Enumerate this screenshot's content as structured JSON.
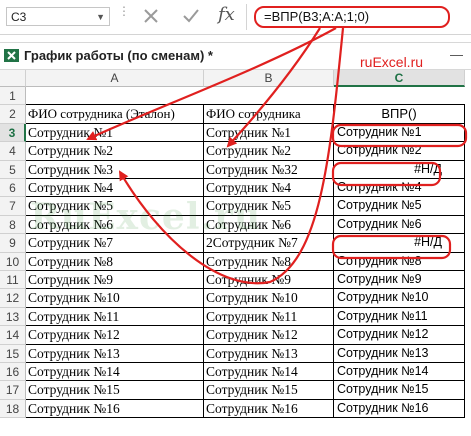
{
  "formula_bar": {
    "name_box": "C3",
    "formula": "=ВПР(B3;A:A;1;0)"
  },
  "workbook": {
    "title": "График работы (по сменам) *",
    "brand": "ruExcel.ru",
    "watermark": "RuExcel.ru"
  },
  "columns": [
    "A",
    "B",
    "C"
  ],
  "rows": [
    {
      "num": "1",
      "a": "",
      "b": "",
      "c": ""
    },
    {
      "num": "2",
      "a": "ФИО сотрудника (Эталон)",
      "b": "ФИО сотрудника",
      "c": "ВПР()"
    },
    {
      "num": "3",
      "a": "Сотрудник №1",
      "b": "Сотрудник №1",
      "c": "Сотрудник №1"
    },
    {
      "num": "4",
      "a": "Сотрудник №2",
      "b": "Сотрудник №2",
      "c": "Сотрудник №2"
    },
    {
      "num": "5",
      "a": "Сотрудник №3",
      "b": "Сотрудник №32",
      "c": "#Н/Д"
    },
    {
      "num": "6",
      "a": "Сотрудник №4",
      "b": "Сотрудник №4",
      "c": "Сотрудник №4"
    },
    {
      "num": "7",
      "a": "Сотрудник №5",
      "b": "Сотрудник №5",
      "c": "Сотрудник №5"
    },
    {
      "num": "8",
      "a": "Сотрудник №6",
      "b": "Сотрудник №6",
      "c": "Сотрудник №6"
    },
    {
      "num": "9",
      "a": "Сотрудник №7",
      "b": "2Сотрудник №7",
      "c": "#Н/Д"
    },
    {
      "num": "10",
      "a": "Сотрудник №8",
      "b": "Сотрудник №8",
      "c": "Сотрудник №8"
    },
    {
      "num": "11",
      "a": "Сотрудник №9",
      "b": "Сотрудник №9",
      "c": "Сотрудник №9"
    },
    {
      "num": "12",
      "a": "Сотрудник №10",
      "b": "Сотрудник №10",
      "c": "Сотрудник №10"
    },
    {
      "num": "13",
      "a": "Сотрудник №11",
      "b": "Сотрудник №11",
      "c": "Сотрудник №11"
    },
    {
      "num": "14",
      "a": "Сотрудник №12",
      "b": "Сотрудник №12",
      "c": "Сотрудник №12"
    },
    {
      "num": "15",
      "a": "Сотрудник №13",
      "b": "Сотрудник №13",
      "c": "Сотрудник №13"
    },
    {
      "num": "16",
      "a": "Сотрудник №14",
      "b": "Сотрудник №14",
      "c": "Сотрудник №14"
    },
    {
      "num": "17",
      "a": "Сотрудник №15",
      "b": "Сотрудник №15",
      "c": "Сотрудник №15"
    },
    {
      "num": "18",
      "a": "Сотрудник №16",
      "b": "Сотрудник №16",
      "c": "Сотрудник №16"
    }
  ],
  "colors": {
    "annotation": "#e0201f",
    "excel_green": "#217346"
  }
}
